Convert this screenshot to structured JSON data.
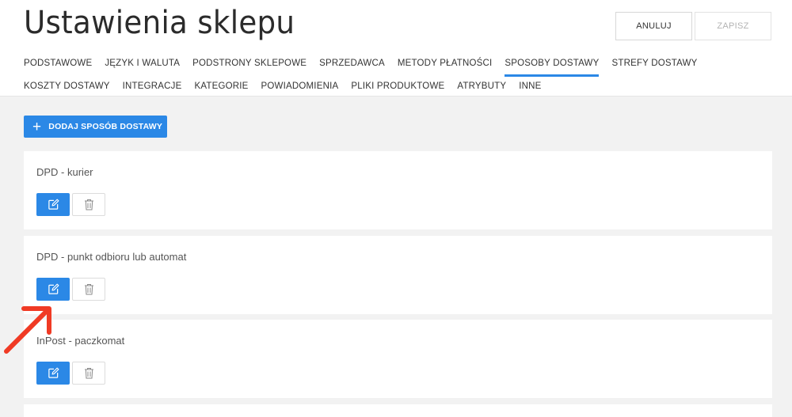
{
  "header": {
    "title": "Ustawienia sklepu",
    "cancel_label": "ANULUJ",
    "save_label": "ZAPISZ"
  },
  "tabs": [
    {
      "label": "PODSTAWOWE",
      "active": false
    },
    {
      "label": "JĘZYK I WALUTA",
      "active": false
    },
    {
      "label": "PODSTRONY SKLEPOWE",
      "active": false
    },
    {
      "label": "SPRZEDAWCA",
      "active": false
    },
    {
      "label": "METODY PŁATNOŚCI",
      "active": false
    },
    {
      "label": "SPOSOBY DOSTAWY",
      "active": true
    },
    {
      "label": "STREFY DOSTAWY",
      "active": false
    },
    {
      "label": "KOSZTY DOSTAWY",
      "active": false
    },
    {
      "label": "INTEGRACJE",
      "active": false
    },
    {
      "label": "KATEGORIE",
      "active": false
    },
    {
      "label": "POWIADOMIENIA",
      "active": false
    },
    {
      "label": "PLIKI PRODUKTOWE",
      "active": false
    },
    {
      "label": "ATRYBUTY",
      "active": false
    },
    {
      "label": "INNE",
      "active": false
    }
  ],
  "add_button": {
    "icon": "plus-icon",
    "label": "DODAJ SPOSÓB DOSTAWY"
  },
  "delivery_methods": [
    {
      "name": "DPD - kurier"
    },
    {
      "name": "DPD - punkt odbioru lub automat"
    },
    {
      "name": "InPost - paczkomat"
    }
  ],
  "colors": {
    "accent": "#2b88e6",
    "annotation_arrow": "#f03a24",
    "background": "#f2f2f2"
  },
  "icons": {
    "edit": "edit-icon",
    "delete": "trash-icon",
    "annotation": "red-arrow-annotation"
  }
}
